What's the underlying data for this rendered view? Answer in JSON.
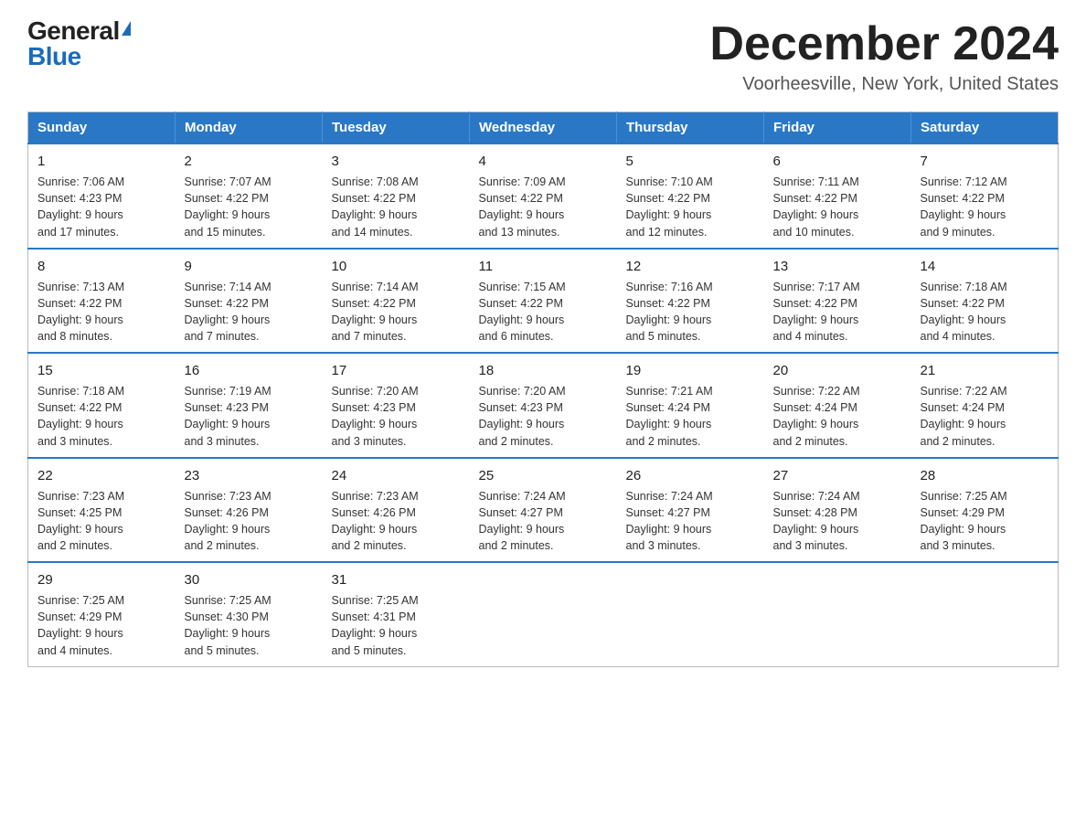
{
  "logo": {
    "general": "General",
    "blue": "Blue"
  },
  "header": {
    "title": "December 2024",
    "location": "Voorheesville, New York, United States"
  },
  "weekdays": [
    "Sunday",
    "Monday",
    "Tuesday",
    "Wednesday",
    "Thursday",
    "Friday",
    "Saturday"
  ],
  "weeks": [
    [
      {
        "day": "1",
        "sunrise": "7:06 AM",
        "sunset": "4:23 PM",
        "daylight": "9 hours and 17 minutes."
      },
      {
        "day": "2",
        "sunrise": "7:07 AM",
        "sunset": "4:22 PM",
        "daylight": "9 hours and 15 minutes."
      },
      {
        "day": "3",
        "sunrise": "7:08 AM",
        "sunset": "4:22 PM",
        "daylight": "9 hours and 14 minutes."
      },
      {
        "day": "4",
        "sunrise": "7:09 AM",
        "sunset": "4:22 PM",
        "daylight": "9 hours and 13 minutes."
      },
      {
        "day": "5",
        "sunrise": "7:10 AM",
        "sunset": "4:22 PM",
        "daylight": "9 hours and 12 minutes."
      },
      {
        "day": "6",
        "sunrise": "7:11 AM",
        "sunset": "4:22 PM",
        "daylight": "9 hours and 10 minutes."
      },
      {
        "day": "7",
        "sunrise": "7:12 AM",
        "sunset": "4:22 PM",
        "daylight": "9 hours and 9 minutes."
      }
    ],
    [
      {
        "day": "8",
        "sunrise": "7:13 AM",
        "sunset": "4:22 PM",
        "daylight": "9 hours and 8 minutes."
      },
      {
        "day": "9",
        "sunrise": "7:14 AM",
        "sunset": "4:22 PM",
        "daylight": "9 hours and 7 minutes."
      },
      {
        "day": "10",
        "sunrise": "7:14 AM",
        "sunset": "4:22 PM",
        "daylight": "9 hours and 7 minutes."
      },
      {
        "day": "11",
        "sunrise": "7:15 AM",
        "sunset": "4:22 PM",
        "daylight": "9 hours and 6 minutes."
      },
      {
        "day": "12",
        "sunrise": "7:16 AM",
        "sunset": "4:22 PM",
        "daylight": "9 hours and 5 minutes."
      },
      {
        "day": "13",
        "sunrise": "7:17 AM",
        "sunset": "4:22 PM",
        "daylight": "9 hours and 4 minutes."
      },
      {
        "day": "14",
        "sunrise": "7:18 AM",
        "sunset": "4:22 PM",
        "daylight": "9 hours and 4 minutes."
      }
    ],
    [
      {
        "day": "15",
        "sunrise": "7:18 AM",
        "sunset": "4:22 PM",
        "daylight": "9 hours and 3 minutes."
      },
      {
        "day": "16",
        "sunrise": "7:19 AM",
        "sunset": "4:23 PM",
        "daylight": "9 hours and 3 minutes."
      },
      {
        "day": "17",
        "sunrise": "7:20 AM",
        "sunset": "4:23 PM",
        "daylight": "9 hours and 3 minutes."
      },
      {
        "day": "18",
        "sunrise": "7:20 AM",
        "sunset": "4:23 PM",
        "daylight": "9 hours and 2 minutes."
      },
      {
        "day": "19",
        "sunrise": "7:21 AM",
        "sunset": "4:24 PM",
        "daylight": "9 hours and 2 minutes."
      },
      {
        "day": "20",
        "sunrise": "7:22 AM",
        "sunset": "4:24 PM",
        "daylight": "9 hours and 2 minutes."
      },
      {
        "day": "21",
        "sunrise": "7:22 AM",
        "sunset": "4:24 PM",
        "daylight": "9 hours and 2 minutes."
      }
    ],
    [
      {
        "day": "22",
        "sunrise": "7:23 AM",
        "sunset": "4:25 PM",
        "daylight": "9 hours and 2 minutes."
      },
      {
        "day": "23",
        "sunrise": "7:23 AM",
        "sunset": "4:26 PM",
        "daylight": "9 hours and 2 minutes."
      },
      {
        "day": "24",
        "sunrise": "7:23 AM",
        "sunset": "4:26 PM",
        "daylight": "9 hours and 2 minutes."
      },
      {
        "day": "25",
        "sunrise": "7:24 AM",
        "sunset": "4:27 PM",
        "daylight": "9 hours and 2 minutes."
      },
      {
        "day": "26",
        "sunrise": "7:24 AM",
        "sunset": "4:27 PM",
        "daylight": "9 hours and 3 minutes."
      },
      {
        "day": "27",
        "sunrise": "7:24 AM",
        "sunset": "4:28 PM",
        "daylight": "9 hours and 3 minutes."
      },
      {
        "day": "28",
        "sunrise": "7:25 AM",
        "sunset": "4:29 PM",
        "daylight": "9 hours and 3 minutes."
      }
    ],
    [
      {
        "day": "29",
        "sunrise": "7:25 AM",
        "sunset": "4:29 PM",
        "daylight": "9 hours and 4 minutes."
      },
      {
        "day": "30",
        "sunrise": "7:25 AM",
        "sunset": "4:30 PM",
        "daylight": "9 hours and 5 minutes."
      },
      {
        "day": "31",
        "sunrise": "7:25 AM",
        "sunset": "4:31 PM",
        "daylight": "9 hours and 5 minutes."
      },
      null,
      null,
      null,
      null
    ]
  ],
  "labels": {
    "sunrise": "Sunrise:",
    "sunset": "Sunset:",
    "daylight": "Daylight:"
  }
}
